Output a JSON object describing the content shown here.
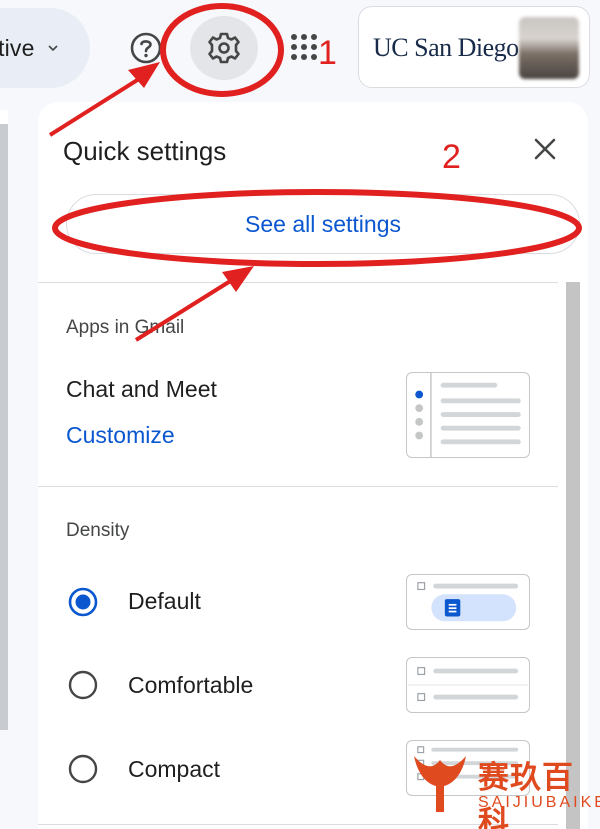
{
  "topbar": {
    "status_label": "tive",
    "org_logo_text": "UC San Diego"
  },
  "panel": {
    "title": "Quick settings",
    "see_all_label": "See all settings",
    "apps_section": {
      "title": "Apps in Gmail",
      "row_label": "Chat and Meet",
      "action_label": "Customize"
    },
    "density_section": {
      "title": "Density",
      "options": [
        {
          "label": "Default",
          "selected": true
        },
        {
          "label": "Comfortable",
          "selected": false
        },
        {
          "label": "Compact",
          "selected": false
        }
      ]
    }
  },
  "annotations": {
    "step1": "1",
    "step2": "2",
    "color": "#e0211f"
  },
  "watermark": {
    "text": "赛玖百科",
    "sub": "SAIJIUBAIKE"
  },
  "colors": {
    "accent": "#0b57d0",
    "radio_selected": "#0b57d0",
    "annotation_red": "#e0211f"
  }
}
